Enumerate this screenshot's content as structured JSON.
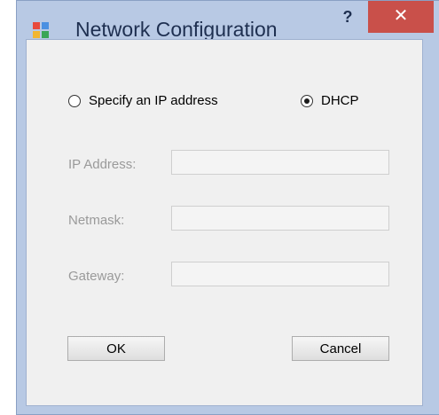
{
  "window": {
    "title": "Network Configuration",
    "help_label": "?",
    "close_label": "✕"
  },
  "mode": {
    "options": [
      {
        "label": "Specify an IP address",
        "checked": false
      },
      {
        "label": "DHCP",
        "checked": true
      }
    ]
  },
  "fields": {
    "ip_address": {
      "label": "IP Address:",
      "value": ""
    },
    "netmask": {
      "label": "Netmask:",
      "value": ""
    },
    "gateway": {
      "label": "Gateway:",
      "value": ""
    }
  },
  "buttons": {
    "ok_label": "OK",
    "cancel_label": "Cancel"
  },
  "colors": {
    "frame": "#b8c9e4",
    "close": "#c9504a",
    "client": "#f0f0f0",
    "disabled_text": "#9a9a9a"
  }
}
